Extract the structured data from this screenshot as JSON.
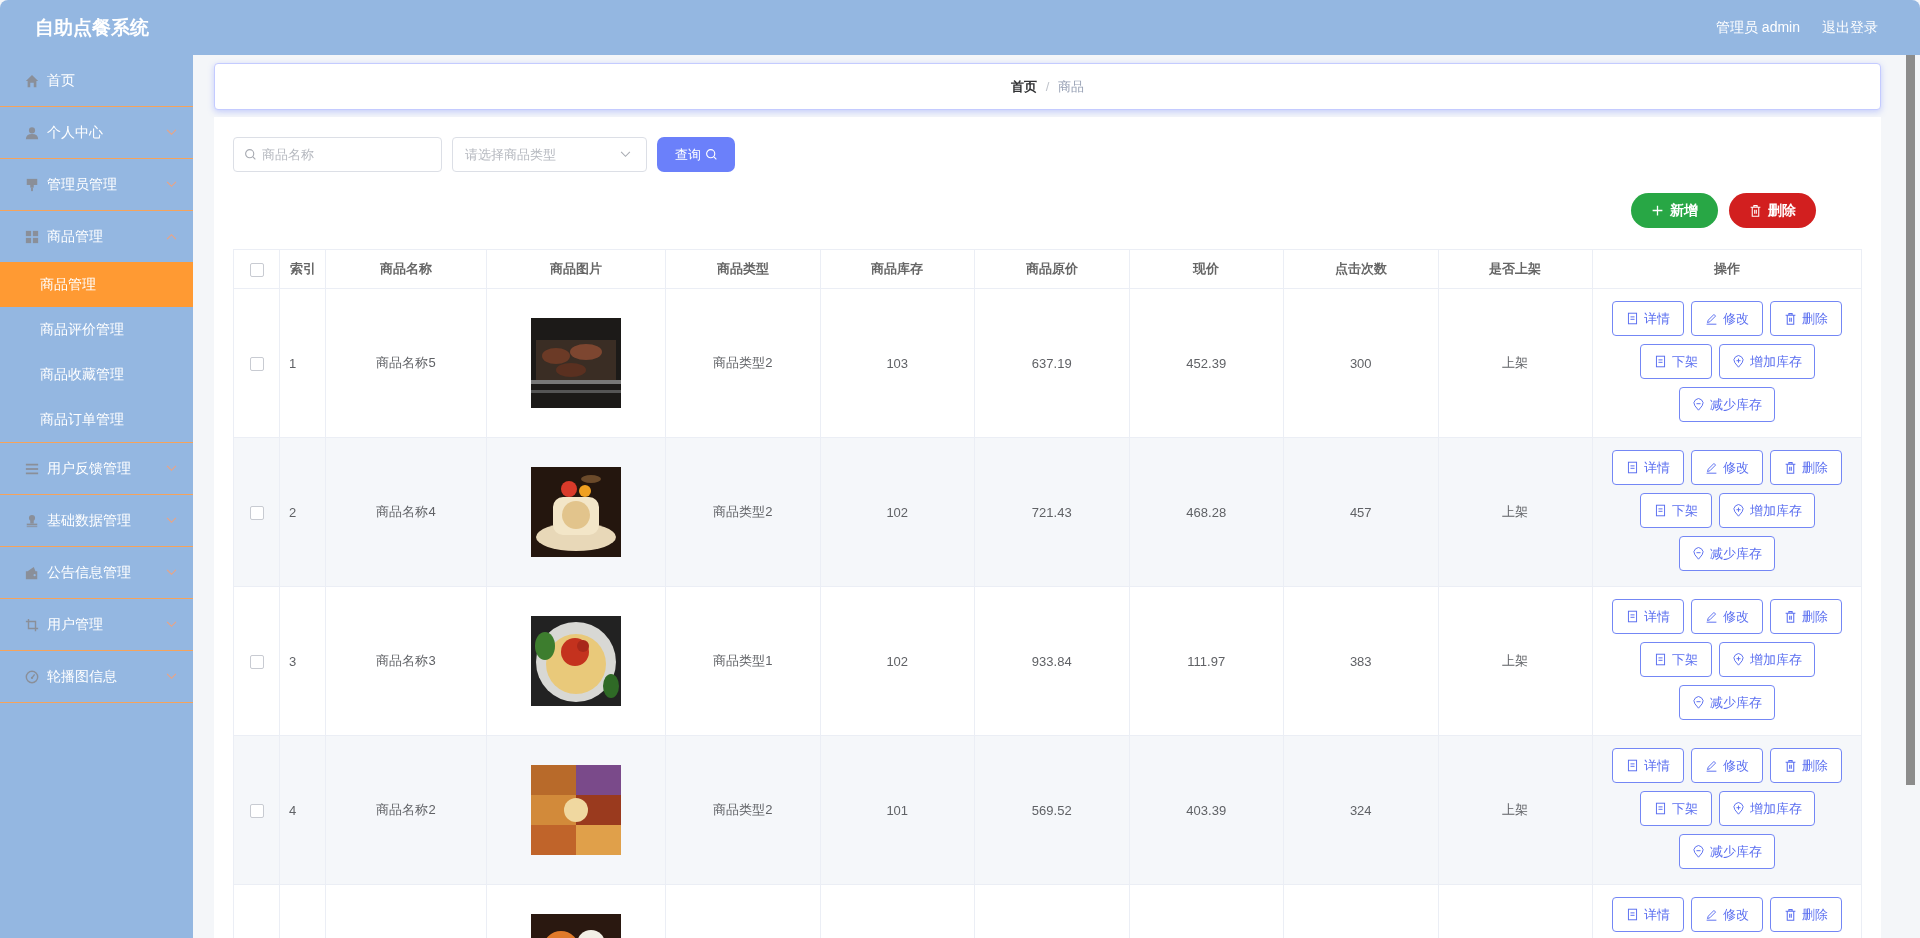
{
  "header": {
    "title": "自助点餐系统",
    "user_label": "管理员 admin",
    "logout": "退出登录"
  },
  "sidebar": {
    "items": [
      {
        "label": "首页",
        "kind": "link",
        "selected": false
      },
      {
        "label": "个人中心",
        "kind": "menu",
        "expanded": false
      },
      {
        "label": "管理员管理",
        "kind": "menu",
        "expanded": false
      },
      {
        "label": "商品管理",
        "kind": "menu",
        "expanded": true,
        "children": [
          {
            "label": "商品管理",
            "selected": true
          },
          {
            "label": "商品评价管理",
            "selected": false
          },
          {
            "label": "商品收藏管理",
            "selected": false
          },
          {
            "label": "商品订单管理",
            "selected": false
          }
        ]
      },
      {
        "label": "用户反馈管理",
        "kind": "menu",
        "expanded": false
      },
      {
        "label": "基础数据管理",
        "kind": "menu",
        "expanded": false
      },
      {
        "label": "公告信息管理",
        "kind": "menu",
        "expanded": false
      },
      {
        "label": "用户管理",
        "kind": "menu",
        "expanded": false
      },
      {
        "label": "轮播图信息",
        "kind": "menu",
        "expanded": false
      }
    ]
  },
  "breadcrumb": [
    {
      "label": "首页",
      "current": false
    },
    {
      "label": "商品",
      "current": true,
      "separator": "/"
    }
  ],
  "search": {
    "name_field": {
      "placeholder": "商品名称"
    },
    "type_select": {
      "placeholder": "请选择商品类型"
    },
    "query_button": "查询"
  },
  "actions": [
    {
      "label": "新增",
      "kind": "add"
    },
    {
      "label": "删除",
      "kind": "delete"
    }
  ],
  "table": {
    "select_all_checked": false,
    "columns": [
      "索引",
      "商品名称",
      "商品图片",
      "商品类型",
      "商品库存",
      "商品原价",
      "现价",
      "点击次数",
      "是否上架",
      "操作"
    ],
    "rows": [
      {
        "checked": false,
        "index": "1",
        "name": "商品名称5",
        "type": "商品类型2",
        "stock": "103",
        "price": "637.19",
        "current_price": "452.39",
        "clicks": "300",
        "on_shelf": "上架",
        "buttons": [
          {
            "label": "详情",
            "kind": "detail"
          },
          {
            "label": "修改",
            "kind": "edit"
          },
          {
            "label": "删除",
            "kind": "delete"
          },
          {
            "label": "下架",
            "kind": "detail"
          },
          {
            "label": "增加库存",
            "kind": "add_stock"
          },
          {
            "label": "减少库存",
            "kind": "reduce_stock"
          }
        ]
      },
      {
        "checked": false,
        "index": "2",
        "name": "商品名称4",
        "type": "商品类型2",
        "stock": "102",
        "price": "721.43",
        "current_price": "468.28",
        "clicks": "457",
        "on_shelf": "上架",
        "buttons": [
          {
            "label": "详情",
            "kind": "detail"
          },
          {
            "label": "修改",
            "kind": "edit"
          },
          {
            "label": "删除",
            "kind": "delete"
          },
          {
            "label": "下架",
            "kind": "detail"
          },
          {
            "label": "增加库存",
            "kind": "add_stock"
          },
          {
            "label": "减少库存",
            "kind": "reduce_stock"
          }
        ]
      },
      {
        "checked": false,
        "index": "3",
        "name": "商品名称3",
        "type": "商品类型1",
        "stock": "102",
        "price": "933.84",
        "current_price": "111.97",
        "clicks": "383",
        "on_shelf": "上架",
        "buttons": [
          {
            "label": "详情",
            "kind": "detail"
          },
          {
            "label": "修改",
            "kind": "edit"
          },
          {
            "label": "删除",
            "kind": "delete"
          },
          {
            "label": "下架",
            "kind": "detail"
          },
          {
            "label": "增加库存",
            "kind": "add_stock"
          },
          {
            "label": "减少库存",
            "kind": "reduce_stock"
          }
        ]
      },
      {
        "checked": false,
        "index": "4",
        "name": "商品名称2",
        "type": "商品类型2",
        "stock": "101",
        "price": "569.52",
        "current_price": "403.39",
        "clicks": "324",
        "on_shelf": "上架",
        "buttons": [
          {
            "label": "详情",
            "kind": "detail"
          },
          {
            "label": "修改",
            "kind": "edit"
          },
          {
            "label": "删除",
            "kind": "delete"
          },
          {
            "label": "下架",
            "kind": "detail"
          },
          {
            "label": "增加库存",
            "kind": "add_stock"
          },
          {
            "label": "减少库存",
            "kind": "reduce_stock"
          }
        ]
      },
      {
        "buttons": [
          {
            "label": "详情",
            "kind": "detail"
          },
          {
            "label": "修改",
            "kind": "edit"
          },
          {
            "label": "删除",
            "kind": "delete"
          }
        ]
      }
    ]
  }
}
